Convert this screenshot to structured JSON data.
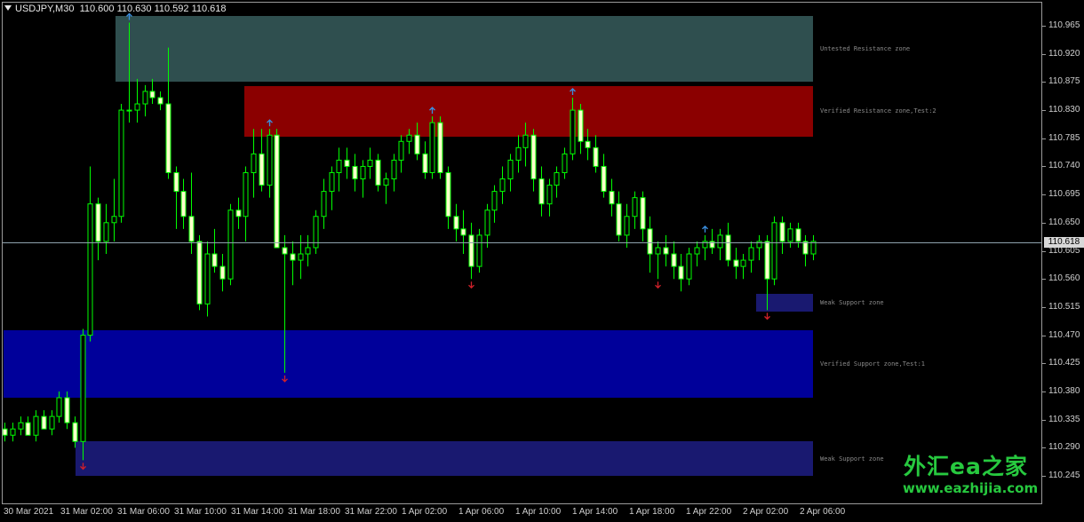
{
  "header": {
    "symbol": "USDJPY,M30",
    "ohlc": "110.600 110.630 110.592 110.618"
  },
  "current_price": "110.618",
  "price_axis": [
    "110.965",
    "110.920",
    "110.875",
    "110.830",
    "110.785",
    "110.740",
    "110.695",
    "110.650",
    "110.605",
    "110.560",
    "110.515",
    "110.470",
    "110.425",
    "110.380",
    "110.335",
    "110.290",
    "110.245"
  ],
  "time_axis": [
    "30 Mar 2021",
    "31 Mar 02:00",
    "31 Mar 06:00",
    "31 Mar 10:00",
    "31 Mar 14:00",
    "31 Mar 18:00",
    "31 Mar 22:00",
    "1 Apr 02:00",
    "1 Apr 06:00",
    "1 Apr 10:00",
    "1 Apr 14:00",
    "1 Apr 18:00",
    "1 Apr 22:00",
    "2 Apr 02:00",
    "2 Apr 06:00"
  ],
  "zones": [
    {
      "label": "Untested Resistance zone",
      "color": "#2f4f4f"
    },
    {
      "label": "Verified Resistance zone,Test:2",
      "color": "#8b0000"
    },
    {
      "label": "Weak Support zone",
      "color": "#191970"
    },
    {
      "label": "Verified Support zone,Test:1",
      "color": "#00009a"
    },
    {
      "label": "Weak Support zone",
      "color": "#191970"
    }
  ],
  "watermark": {
    "cn": "外汇ea之家",
    "url": "www.eazhijia.com"
  },
  "colors": {
    "bull": "#ffffcc",
    "bear": "#ffffcc",
    "wick": "#00ff00",
    "fractal_up": "#3b8fe0",
    "fractal_down": "#d0202a"
  },
  "chart_data": {
    "type": "candlestick",
    "title": "USDJPY,M30",
    "ylim": [
      110.245,
      110.98
    ],
    "candles": [
      [
        110.32,
        110.33,
        110.3,
        110.31
      ],
      [
        110.31,
        110.33,
        110.3,
        110.32
      ],
      [
        110.32,
        110.34,
        110.31,
        110.33
      ],
      [
        110.33,
        110.34,
        110.31,
        110.31
      ],
      [
        110.31,
        110.35,
        110.3,
        110.34
      ],
      [
        110.34,
        110.35,
        110.32,
        110.32
      ],
      [
        110.32,
        110.35,
        110.31,
        110.34
      ],
      [
        110.34,
        110.38,
        110.33,
        110.37
      ],
      [
        110.37,
        110.38,
        110.32,
        110.33
      ],
      [
        110.33,
        110.34,
        110.29,
        110.3
      ],
      [
        110.3,
        110.48,
        110.27,
        110.47
      ],
      [
        110.47,
        110.74,
        110.46,
        110.68
      ],
      [
        110.68,
        110.69,
        110.59,
        110.62
      ],
      [
        110.62,
        110.68,
        110.6,
        110.65
      ],
      [
        110.65,
        110.72,
        110.62,
        110.66
      ],
      [
        110.66,
        110.84,
        110.65,
        110.83
      ],
      [
        110.83,
        110.97,
        110.81,
        110.83
      ],
      [
        110.83,
        110.88,
        110.81,
        110.84
      ],
      [
        110.84,
        110.87,
        110.82,
        110.86
      ],
      [
        110.86,
        110.88,
        110.84,
        110.85
      ],
      [
        110.85,
        110.86,
        110.83,
        110.84
      ],
      [
        110.84,
        110.93,
        110.72,
        110.73
      ],
      [
        110.73,
        110.74,
        110.64,
        110.7
      ],
      [
        110.7,
        110.72,
        110.64,
        110.66
      ],
      [
        110.66,
        110.73,
        110.6,
        110.62
      ],
      [
        110.62,
        110.63,
        110.51,
        110.52
      ],
      [
        110.52,
        110.62,
        110.5,
        110.6
      ],
      [
        110.6,
        110.64,
        110.57,
        110.58
      ],
      [
        110.58,
        110.6,
        110.54,
        110.56
      ],
      [
        110.56,
        110.68,
        110.55,
        110.67
      ],
      [
        110.67,
        110.69,
        110.64,
        110.66
      ],
      [
        110.66,
        110.74,
        110.62,
        110.73
      ],
      [
        110.73,
        110.8,
        110.69,
        110.76
      ],
      [
        110.76,
        110.8,
        110.7,
        110.71
      ],
      [
        110.71,
        110.8,
        110.69,
        110.79
      ],
      [
        110.79,
        110.8,
        110.61,
        110.61
      ],
      [
        110.61,
        110.63,
        110.41,
        110.6
      ],
      [
        110.6,
        110.62,
        110.55,
        110.59
      ],
      [
        110.59,
        110.63,
        110.56,
        110.6
      ],
      [
        110.6,
        110.63,
        110.58,
        110.61
      ],
      [
        110.61,
        110.67,
        110.6,
        110.66
      ],
      [
        110.66,
        110.72,
        110.64,
        110.7
      ],
      [
        110.7,
        110.74,
        110.67,
        110.73
      ],
      [
        110.73,
        110.77,
        110.7,
        110.75
      ],
      [
        110.75,
        110.77,
        110.72,
        110.74
      ],
      [
        110.74,
        110.76,
        110.7,
        110.72
      ],
      [
        110.72,
        110.75,
        110.69,
        110.74
      ],
      [
        110.74,
        110.77,
        110.72,
        110.75
      ],
      [
        110.75,
        110.76,
        110.7,
        110.71
      ],
      [
        110.71,
        110.73,
        110.68,
        110.72
      ],
      [
        110.72,
        110.76,
        110.7,
        110.75
      ],
      [
        110.75,
        110.79,
        110.73,
        110.78
      ],
      [
        110.78,
        110.8,
        110.76,
        110.79
      ],
      [
        110.79,
        110.81,
        110.75,
        110.76
      ],
      [
        110.76,
        110.78,
        110.72,
        110.73
      ],
      [
        110.73,
        110.82,
        110.72,
        110.81
      ],
      [
        110.81,
        110.82,
        110.72,
        110.73
      ],
      [
        110.73,
        110.74,
        110.64,
        110.66
      ],
      [
        110.66,
        110.68,
        110.62,
        110.64
      ],
      [
        110.64,
        110.67,
        110.6,
        110.63
      ],
      [
        110.63,
        110.65,
        110.56,
        110.58
      ],
      [
        110.58,
        110.64,
        110.57,
        110.63
      ],
      [
        110.63,
        110.68,
        110.61,
        110.67
      ],
      [
        110.67,
        110.71,
        110.65,
        110.7
      ],
      [
        110.7,
        110.74,
        110.68,
        110.72
      ],
      [
        110.72,
        110.76,
        110.7,
        110.75
      ],
      [
        110.75,
        110.79,
        110.73,
        110.77
      ],
      [
        110.77,
        110.81,
        110.74,
        110.79
      ],
      [
        110.79,
        110.8,
        110.7,
        110.72
      ],
      [
        110.72,
        110.74,
        110.66,
        110.68
      ],
      [
        110.68,
        110.72,
        110.66,
        110.71
      ],
      [
        110.71,
        110.74,
        110.69,
        110.73
      ],
      [
        110.73,
        110.77,
        110.72,
        110.76
      ],
      [
        110.76,
        110.85,
        110.75,
        110.83
      ],
      [
        110.83,
        110.84,
        110.76,
        110.78
      ],
      [
        110.78,
        110.8,
        110.75,
        110.77
      ],
      [
        110.77,
        110.79,
        110.73,
        110.74
      ],
      [
        110.74,
        110.76,
        110.69,
        110.7
      ],
      [
        110.7,
        110.72,
        110.66,
        110.68
      ],
      [
        110.68,
        110.7,
        110.62,
        110.63
      ],
      [
        110.63,
        110.68,
        110.61,
        110.66
      ],
      [
        110.66,
        110.7,
        110.64,
        110.69
      ],
      [
        110.69,
        110.7,
        110.62,
        110.64
      ],
      [
        110.64,
        110.66,
        110.57,
        110.6
      ],
      [
        110.6,
        110.62,
        110.56,
        110.61
      ],
      [
        110.61,
        110.63,
        110.58,
        110.6
      ],
      [
        110.6,
        110.62,
        110.56,
        110.58
      ],
      [
        110.58,
        110.6,
        110.54,
        110.56
      ],
      [
        110.56,
        110.61,
        110.55,
        110.6
      ],
      [
        110.6,
        110.62,
        110.58,
        110.61
      ],
      [
        110.61,
        110.63,
        110.59,
        110.62
      ],
      [
        110.62,
        110.64,
        110.6,
        110.61
      ],
      [
        110.61,
        110.64,
        110.59,
        110.63
      ],
      [
        110.63,
        110.65,
        110.58,
        110.59
      ],
      [
        110.59,
        110.61,
        110.56,
        110.58
      ],
      [
        110.58,
        110.6,
        110.56,
        110.59
      ],
      [
        110.59,
        110.62,
        110.57,
        110.61
      ],
      [
        110.61,
        110.63,
        110.59,
        110.62
      ],
      [
        110.62,
        110.63,
        110.51,
        110.56
      ],
      [
        110.56,
        110.66,
        110.55,
        110.65
      ],
      [
        110.65,
        110.66,
        110.6,
        110.62
      ],
      [
        110.62,
        110.65,
        110.61,
        110.64
      ],
      [
        110.64,
        110.65,
        110.61,
        110.62
      ],
      [
        110.62,
        110.63,
        110.58,
        110.6
      ],
      [
        110.6,
        110.63,
        110.59,
        110.62
      ]
    ],
    "zones": [
      {
        "label": "Untested Resistance zone",
        "low": 110.875,
        "high": 110.98
      },
      {
        "label": "Verified Resistance zone,Test:2",
        "low": 110.788,
        "high": 110.868
      },
      {
        "label": "Weak Support zone",
        "low": 110.508,
        "high": 110.536
      },
      {
        "label": "Verified Support zone,Test:1",
        "low": 110.37,
        "high": 110.478
      },
      {
        "label": "Weak Support zone",
        "low": 110.245,
        "high": 110.3
      }
    ],
    "fractals": [
      {
        "index": 16,
        "type": "up"
      },
      {
        "index": 10,
        "type": "down"
      },
      {
        "index": 36,
        "type": "down"
      },
      {
        "index": 34,
        "type": "up"
      },
      {
        "index": 55,
        "type": "up"
      },
      {
        "index": 60,
        "type": "down"
      },
      {
        "index": 73,
        "type": "up"
      },
      {
        "index": 84,
        "type": "down"
      },
      {
        "index": 90,
        "type": "up"
      },
      {
        "index": 98,
        "type": "down"
      }
    ]
  }
}
